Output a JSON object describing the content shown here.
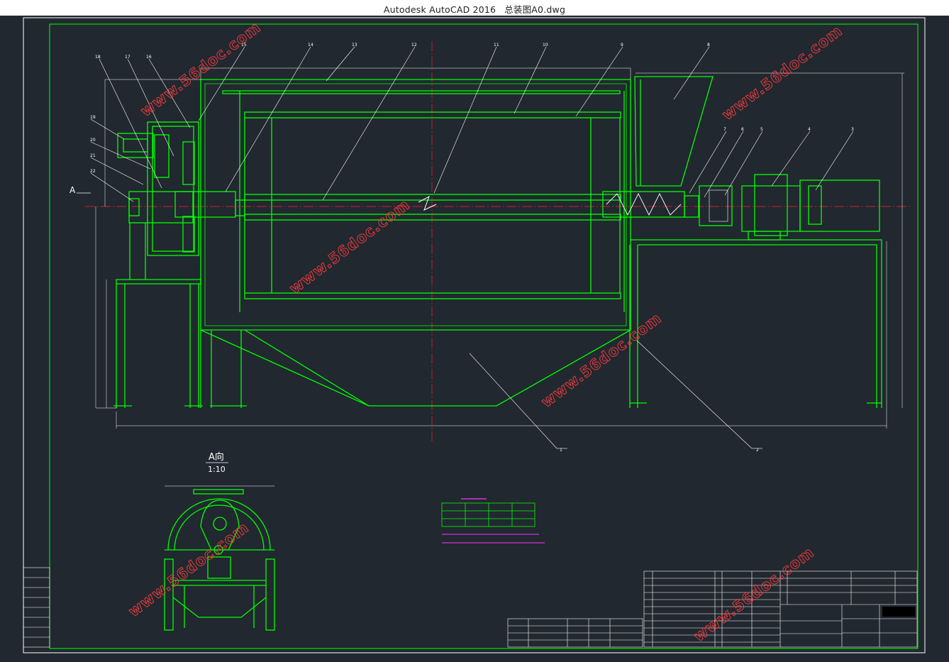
{
  "window": {
    "app_name": "Autodesk AutoCAD 2016",
    "file_name": "总装图A0.dwg"
  },
  "view": {
    "label": "A向",
    "scale": "1:10",
    "section_marker": "A"
  },
  "balloons": [
    "1",
    "2",
    "3",
    "4",
    "5",
    "6",
    "7",
    "8",
    "9",
    "10",
    "11",
    "12",
    "13",
    "14",
    "15",
    "16",
    "17",
    "18",
    "19",
    "20",
    "21",
    "22"
  ],
  "watermark": "www.56doc.com",
  "colors": {
    "background": "#212830",
    "outline": "#00ff00",
    "leader": "#ffffff",
    "centerline": "#ff2020",
    "table_text": "#ff33ff",
    "watermark": "#ff3b3b"
  }
}
